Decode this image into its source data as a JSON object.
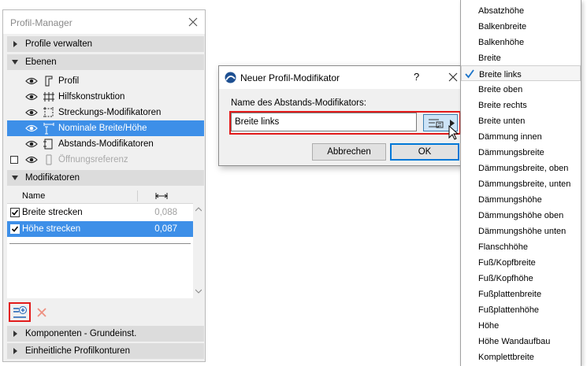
{
  "profile_manager": {
    "title": "Profil-Manager",
    "sections": {
      "profile_verwalten": "Profile verwalten",
      "ebenen": "Ebenen",
      "modifikatoren": "Modifikatoren",
      "komponenten": "Komponenten - Grundeinst.",
      "profilkonturen": "Einheitliche Profilkonturen"
    },
    "layers": [
      {
        "label": "Profil"
      },
      {
        "label": "Hilfskonstruktion"
      },
      {
        "label": "Streckungs-Modifikatoren"
      },
      {
        "label": "Nominale Breite/Höhe"
      },
      {
        "label": "Abstands-Modifikatoren"
      },
      {
        "label": "Öffnungsreferenz"
      }
    ],
    "table": {
      "col_name": "Name",
      "rows": [
        {
          "label": "Breite strecken",
          "value": "0,088"
        },
        {
          "label": "Höhe strecken",
          "value": "0,087"
        }
      ]
    }
  },
  "dialog": {
    "title": "Neuer Profil-Modifikator",
    "help": "?",
    "field_label": "Name des Abstands-Modifikators:",
    "field_value": "Breite links",
    "cancel_label": "Abbrechen",
    "ok_label": "OK"
  },
  "menu": {
    "selected": "Breite links",
    "items": [
      "Absatzhöhe",
      "Balkenbreite",
      "Balkenhöhe",
      "Breite",
      "Breite links",
      "Breite oben",
      "Breite rechts",
      "Breite unten",
      "Dämmung innen",
      "Dämmungsbreite",
      "Dämmungsbreite, oben",
      "Dämmungsbreite, unten",
      "Dämmungshöhe",
      "Dämmungshöhe oben",
      "Dämmungshöhe unten",
      "Flanschhöhe",
      "Fuß/Kopfbreite",
      "Fuß/Kopfhöhe",
      "Fußplattenbreite",
      "Fußplattenhöhe",
      "Höhe",
      "Höhe Wandaufbau",
      "Komplettbreite"
    ]
  },
  "colors": {
    "selection": "#3d8fe8",
    "highlight_frame": "#e21b1b",
    "check_mark": "#1a73c9"
  }
}
